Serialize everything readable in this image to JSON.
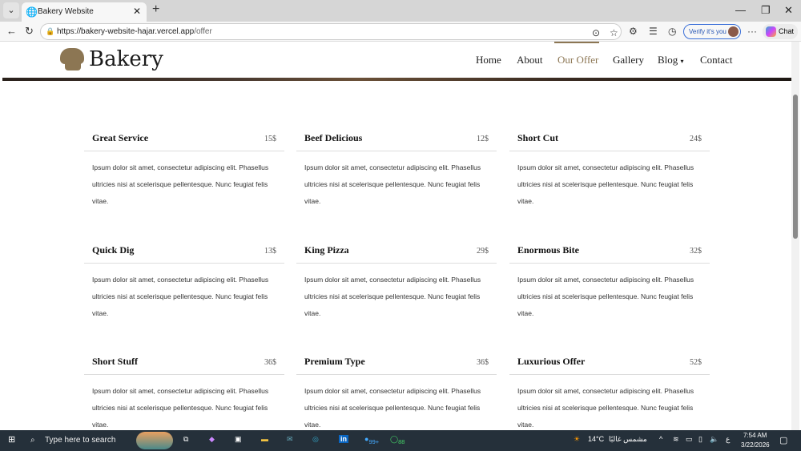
{
  "browser": {
    "tab_title": "Bakery Website",
    "url_host": "https://bakery-website-hajar.vercel.app",
    "url_path": "/offer",
    "verify_label": "Verify it's you",
    "chat_label": "Chat"
  },
  "site": {
    "logo": "Bakery",
    "nav": [
      "Home",
      "About",
      "Our Offer",
      "Gallery",
      "Blog",
      "Contact"
    ],
    "active": "Our Offer"
  },
  "offers": [
    {
      "name": "Great Service",
      "price": "15$"
    },
    {
      "name": "Beef Delicious",
      "price": "12$"
    },
    {
      "name": "Short Cut",
      "price": "24$"
    },
    {
      "name": "Quick Dig",
      "price": "13$"
    },
    {
      "name": "King Pizza",
      "price": "29$"
    },
    {
      "name": "Enormous Bite",
      "price": "32$"
    },
    {
      "name": "Short Stuff",
      "price": "36$"
    },
    {
      "name": "Premium Type",
      "price": "36$"
    },
    {
      "name": "Luxurious Offer",
      "price": "52$"
    }
  ],
  "description": "Ipsum dolor sit amet, consectetur adipiscing elit. Phasellus ultricies nisi at scelerisque pellentesque. Nunc feugiat felis vitae.",
  "taskbar": {
    "search_placeholder": "Type here to search",
    "weather": "14°C",
    "weather_text": "مشمس غالبًا",
    "time": "7:54 AM",
    "date": "3/22/2026",
    "lang": "ع",
    "edge_badge": "99+",
    "whatsapp_badge": "88"
  },
  "colors": {
    "accent": "#8c7653"
  }
}
